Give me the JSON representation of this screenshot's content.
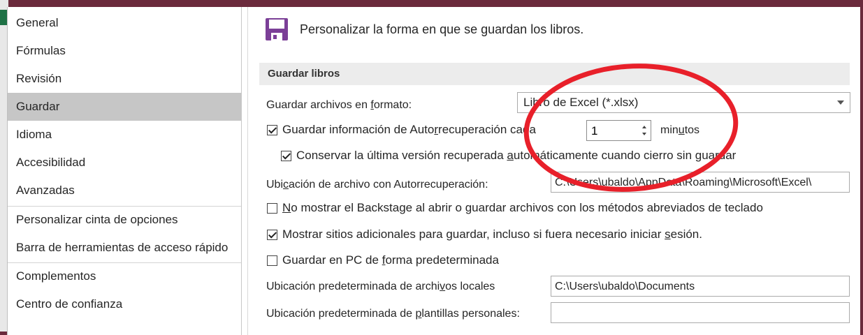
{
  "sidebar": {
    "items": [
      {
        "label": "General"
      },
      {
        "label": "Fórmulas"
      },
      {
        "label": "Revisión"
      },
      {
        "label": "Guardar"
      },
      {
        "label": "Idioma"
      },
      {
        "label": "Accesibilidad"
      },
      {
        "label": "Avanzadas"
      },
      {
        "label": "Personalizar cinta de opciones"
      },
      {
        "label": "Barra de herramientas de acceso rápido"
      },
      {
        "label": "Complementos"
      },
      {
        "label": "Centro de confianza"
      }
    ],
    "selected": "Guardar"
  },
  "header": {
    "icon": "save-icon",
    "text": "Personalizar la forma en que se guardan los libros."
  },
  "section": {
    "title": "Guardar libros"
  },
  "save_format": {
    "label_pre": "Guardar archivos en ",
    "label_key": "f",
    "label_post": "ormato:",
    "value": "Libro de Excel (*.xlsx)"
  },
  "autorecover": {
    "checked": true,
    "label_pre": "Guardar información de Auto",
    "label_key": "r",
    "label_post": "recuperación cada",
    "minutes": "1",
    "unit_pre": "min",
    "unit_key": "u",
    "unit_post": "tos"
  },
  "keep_last": {
    "checked": true,
    "label_pre": "Conservar la última versión recuperada ",
    "label_key": "a",
    "label_post": "utomáticamente cuando cierro sin guardar"
  },
  "autorecover_location": {
    "label_pre": "Ubi",
    "label_key": "c",
    "label_post": "ación de archivo con Autorrecuperación:",
    "value": "C:\\Users\\ubaldo\\AppData\\Roaming\\Microsoft\\Excel\\"
  },
  "no_backstage": {
    "checked": false,
    "label_key": "N",
    "label_post": "o mostrar el Backstage al abrir o guardar archivos con los métodos abreviados de teclado"
  },
  "show_additional": {
    "checked": true,
    "label_pre": "Mostrar sitios adicionales para guardar, incluso si fuera necesario iniciar ",
    "label_key": "s",
    "label_post": "esión."
  },
  "save_pc_default": {
    "checked": false,
    "label_pre": "Guardar en PC de ",
    "label_key": "f",
    "label_post": "orma predeterminada"
  },
  "local_location": {
    "label_pre": "Ubicación predeterminada de archi",
    "label_key": "v",
    "label_post": "os locales",
    "value": "C:\\Users\\ubaldo\\Documents"
  },
  "templates_location": {
    "label_pre": "Ubicación predeterminada de ",
    "label_key": "p",
    "label_post": "lantillas personales:",
    "value": ""
  },
  "colors": {
    "annotation": "#e8202a",
    "selected_bg": "#c6c6c6",
    "save_icon": "#7b3f97"
  }
}
